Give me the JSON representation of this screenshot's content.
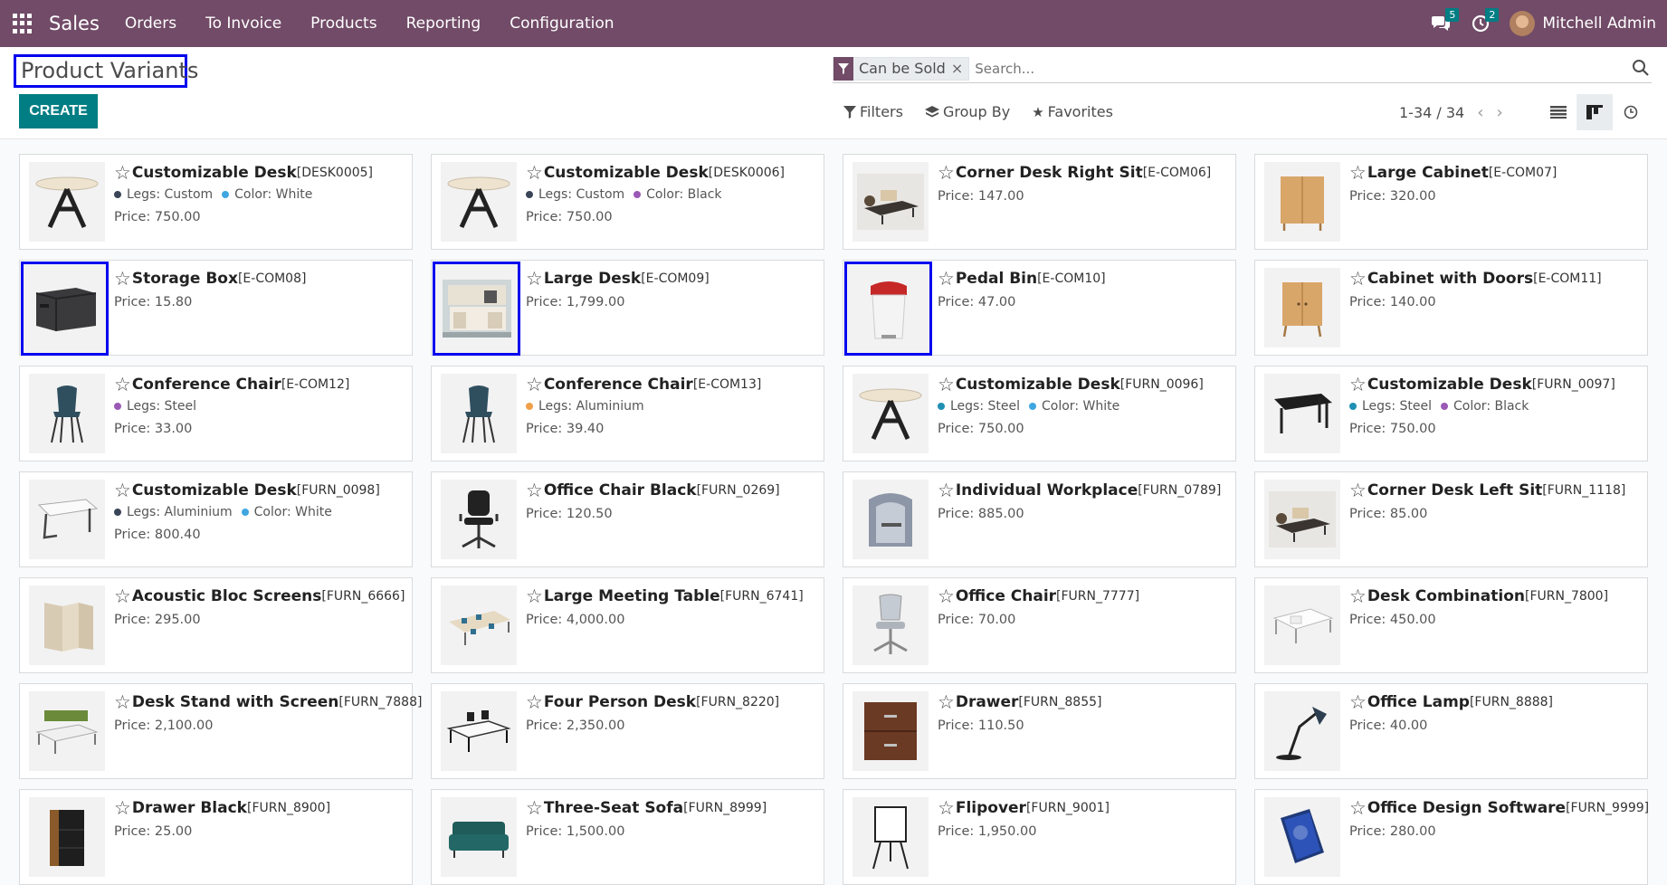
{
  "app": {
    "name": "Sales"
  },
  "menu": [
    "Orders",
    "To Invoice",
    "Products",
    "Reporting",
    "Configuration"
  ],
  "systray": {
    "messages_count": "5",
    "activities_count": "2",
    "user_name": "Mitchell Admin"
  },
  "page": {
    "title": "Product Variants",
    "create_label": "CREATE"
  },
  "search": {
    "facet_label": "Can be Sold",
    "placeholder": "Search..."
  },
  "filters": {
    "filters_label": "Filters",
    "groupby_label": "Group By",
    "favorites_label": "Favorites"
  },
  "pager": {
    "value": "1-34 / 34"
  },
  "colors": {
    "navbar": "#714b67",
    "primary": "#017e84",
    "highlight": "#0000ee"
  },
  "products": [
    {
      "name": "Customizable Desk",
      "code": "[DESK0005]",
      "price": "Price: 750.00",
      "attrs": [
        {
          "label": "Legs: Custom",
          "color": "#3a4557"
        },
        {
          "label": "Color: White",
          "color": "#3fa6e0"
        }
      ],
      "img": "desk-round",
      "hl": false
    },
    {
      "name": "Customizable Desk",
      "code": "[DESK0006]",
      "price": "Price: 750.00",
      "attrs": [
        {
          "label": "Legs: Custom",
          "color": "#3a4557"
        },
        {
          "label": "Color: Black",
          "color": "#9b59b6"
        }
      ],
      "img": "desk-round",
      "hl": false
    },
    {
      "name": "Corner Desk Right Sit",
      "code": "[E-COM06]",
      "price": "Price: 147.00",
      "attrs": [],
      "img": "corner-desk",
      "hl": false
    },
    {
      "name": "Large Cabinet",
      "code": "[E-COM07]",
      "price": "Price: 320.00",
      "attrs": [],
      "img": "cabinet",
      "hl": false
    },
    {
      "name": "Storage Box",
      "code": "[E-COM08]",
      "price": "Price: 15.80",
      "attrs": [],
      "img": "storage-box",
      "hl": true
    },
    {
      "name": "Large Desk",
      "code": "[E-COM09]",
      "price": "Price: 1,799.00",
      "attrs": [],
      "img": "large-desk",
      "hl": true
    },
    {
      "name": "Pedal Bin",
      "code": "[E-COM10]",
      "price": "Price: 47.00",
      "attrs": [],
      "img": "pedal-bin",
      "hl": true
    },
    {
      "name": "Cabinet with Doors",
      "code": "[E-COM11]",
      "price": "Price: 140.00",
      "attrs": [],
      "img": "cabinet-doors",
      "hl": false
    },
    {
      "name": "Conference Chair",
      "code": "[E-COM12]",
      "price": "Price: 33.00",
      "attrs": [
        {
          "label": "Legs: Steel",
          "color": "#9b59b6"
        }
      ],
      "img": "conf-chair",
      "hl": false
    },
    {
      "name": "Conference Chair",
      "code": "[E-COM13]",
      "price": "Price: 39.40",
      "attrs": [
        {
          "label": "Legs: Aluminium",
          "color": "#f0a04b"
        }
      ],
      "img": "conf-chair",
      "hl": false
    },
    {
      "name": "Customizable Desk",
      "code": "[FURN_0096]",
      "price": "Price: 750.00",
      "attrs": [
        {
          "label": "Legs: Steel",
          "color": "#1f8fb3"
        },
        {
          "label": "Color: White",
          "color": "#3fa6e0"
        }
      ],
      "img": "desk-round",
      "hl": false
    },
    {
      "name": "Customizable Desk",
      "code": "[FURN_0097]",
      "price": "Price: 750.00",
      "attrs": [
        {
          "label": "Legs: Steel",
          "color": "#1f8fb3"
        },
        {
          "label": "Color: Black",
          "color": "#9b59b6"
        }
      ],
      "img": "desk-black",
      "hl": false
    },
    {
      "name": "Customizable Desk",
      "code": "[FURN_0098]",
      "price": "Price: 800.40",
      "attrs": [
        {
          "label": "Legs: Aluminium",
          "color": "#3a4557"
        },
        {
          "label": "Color: White",
          "color": "#3fa6e0"
        }
      ],
      "img": "desk-white",
      "hl": false
    },
    {
      "name": "Office Chair Black",
      "code": "[FURN_0269]",
      "price": "Price: 120.50",
      "attrs": [],
      "img": "office-chair-black",
      "hl": false
    },
    {
      "name": "Individual Workplace",
      "code": "[FURN_0789]",
      "price": "Price: 885.00",
      "attrs": [],
      "img": "workplace",
      "hl": false
    },
    {
      "name": "Corner Desk Left Sit",
      "code": "[FURN_1118]",
      "price": "Price: 85.00",
      "attrs": [],
      "img": "corner-desk",
      "hl": false
    },
    {
      "name": "Acoustic Bloc Screens",
      "code": "[FURN_6666]",
      "price": "Price: 295.00",
      "attrs": [],
      "img": "screens",
      "hl": false
    },
    {
      "name": "Large Meeting Table",
      "code": "[FURN_6741]",
      "price": "Price: 4,000.00",
      "attrs": [],
      "img": "meeting-table",
      "hl": false
    },
    {
      "name": "Office Chair",
      "code": "[FURN_7777]",
      "price": "Price: 70.00",
      "attrs": [],
      "img": "office-chair",
      "hl": false
    },
    {
      "name": "Desk Combination",
      "code": "[FURN_7800]",
      "price": "Price: 450.00",
      "attrs": [],
      "img": "desk-combination",
      "hl": false
    },
    {
      "name": "Desk Stand with Screen",
      "code": "[FURN_7888]",
      "price": "Price: 2,100.00",
      "attrs": [],
      "img": "desk-stand",
      "hl": false
    },
    {
      "name": "Four Person Desk",
      "code": "[FURN_8220]",
      "price": "Price: 2,350.00",
      "attrs": [],
      "img": "four-desk",
      "hl": false
    },
    {
      "name": "Drawer",
      "code": "[FURN_8855]",
      "price": "Price: 110.50",
      "attrs": [],
      "img": "drawer",
      "hl": false
    },
    {
      "name": "Office Lamp",
      "code": "[FURN_8888]",
      "price": "Price: 40.00",
      "attrs": [],
      "img": "lamp",
      "hl": false
    },
    {
      "name": "Drawer Black",
      "code": "[FURN_8900]",
      "price": "Price: 25.00",
      "attrs": [],
      "img": "drawer-black",
      "hl": false
    },
    {
      "name": "Three-Seat Sofa",
      "code": "[FURN_8999]",
      "price": "Price: 1,500.00",
      "attrs": [],
      "img": "sofa",
      "hl": false
    },
    {
      "name": "Flipover",
      "code": "[FURN_9001]",
      "price": "Price: 1,950.00",
      "attrs": [],
      "img": "flipover",
      "hl": false
    },
    {
      "name": "Office Design Software",
      "code": "[FURN_9999]",
      "price": "Price: 280.00",
      "attrs": [],
      "img": "software",
      "hl": false
    }
  ]
}
